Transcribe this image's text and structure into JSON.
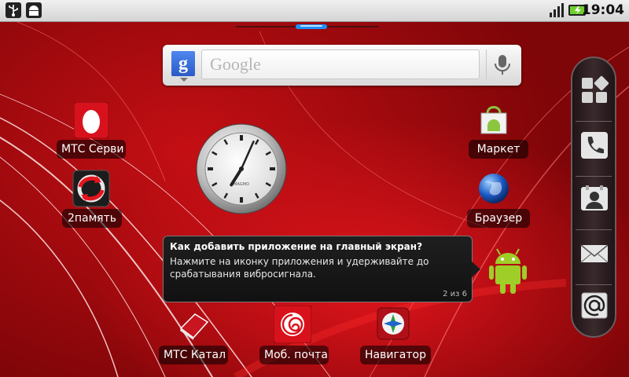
{
  "status_bar": {
    "time": "19:04",
    "left_icons": [
      "usb-icon",
      "android-debug-icon"
    ],
    "right_icons": [
      "signal-icon",
      "battery-charging-icon"
    ]
  },
  "page_indicator": {
    "current_page": 3,
    "total_pages": 5
  },
  "search_widget": {
    "logo_letter": "g",
    "placeholder": "Google",
    "mic_icon": "microphone-icon"
  },
  "apps": {
    "mts_service": {
      "label": "МТС Серви",
      "icon": "mts-egg-icon"
    },
    "memory": {
      "label": "2память",
      "icon": "sync-arrows-icon"
    },
    "market": {
      "label": "Маркет",
      "icon": "market-bag-icon"
    },
    "browser": {
      "label": "Браузер",
      "icon": "globe-icon"
    },
    "catalog": {
      "label": "МТС Катал",
      "icon": "book-icon"
    },
    "mail": {
      "label": "Моб. почта",
      "icon": "at-spiral-icon"
    },
    "navigator": {
      "label": "Навигатор",
      "icon": "compass-icon"
    }
  },
  "clock": {
    "hour": 7,
    "minute": 4,
    "brand": "MAGMO"
  },
  "tooltip": {
    "title": "Как добавить приложение на главный экран?",
    "text": "Нажмите на иконку приложения и удерживайте до срабатывания  вибросигнала.",
    "page": "2 из 6",
    "mascot": "android-robot-icon"
  },
  "dock": {
    "items": [
      {
        "icon": "apps-grid-icon"
      },
      {
        "icon": "phone-icon"
      },
      {
        "icon": "contacts-icon"
      },
      {
        "icon": "envelope-icon"
      },
      {
        "icon": "email-at-icon"
      }
    ]
  },
  "colors": {
    "wallpaper_red": "#c40f14",
    "accent_blue": "#1e90ff",
    "status_bar": "#e0e0e0"
  }
}
